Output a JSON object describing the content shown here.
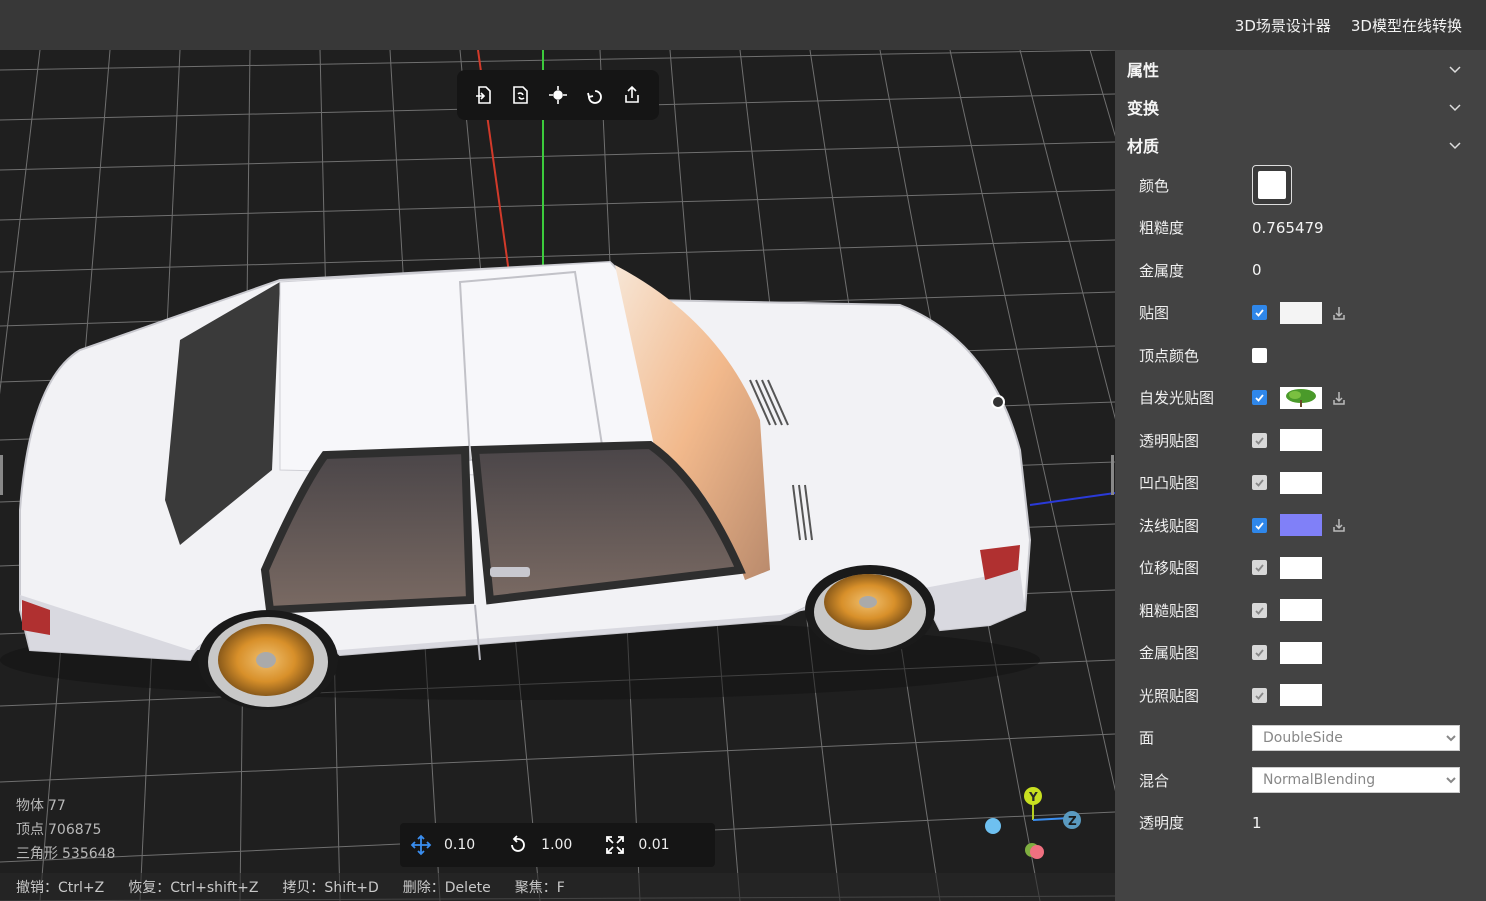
{
  "topbar": {
    "links": [
      "3D场景设计器",
      "3D模型在线转换"
    ]
  },
  "toolbar": {
    "icons": [
      "import-icon",
      "replace-icon",
      "focus-icon",
      "reset-icon",
      "export-icon"
    ]
  },
  "stats": {
    "objects_label": "物体",
    "objects": "77",
    "vertices_label": "顶点",
    "vertices": "706875",
    "triangles_label": "三角形",
    "triangles": "535648"
  },
  "hotkeys": [
    "撤销：Ctrl+Z",
    "恢复：Ctrl+shift+Z",
    "拷贝：Shift+D",
    "删除：Delete",
    "聚焦：F"
  ],
  "transform": {
    "translate": "0.10",
    "rotate": "1.00",
    "scale": "0.01"
  },
  "gizmo": {
    "y": "Y",
    "z": "Z"
  },
  "panel": {
    "sections": [
      "属性",
      "变换",
      "材质"
    ],
    "material": {
      "color_label": "颜色",
      "roughness_label": "粗糙度",
      "roughness": "0.765479",
      "metalness_label": "金属度",
      "metalness": "0",
      "map_label": "贴图",
      "vertex_colors_label": "顶点颜色",
      "emissive_map_label": "自发光贴图",
      "alpha_map_label": "透明贴图",
      "bump_map_label": "凹凸贴图",
      "normal_map_label": "法线贴图",
      "displacement_map_label": "位移贴图",
      "roughness_map_label": "粗糙贴图",
      "metalness_map_label": "金属贴图",
      "light_map_label": "光照贴图",
      "side_label": "面",
      "side": "DoubleSide",
      "blending_label": "混合",
      "blending": "NormalBlending",
      "opacity_label": "透明度",
      "opacity": "1"
    }
  },
  "colors": {
    "checkbox_on": "#2f87ea",
    "normal_map": "#8080f8",
    "panel_bg": "#434343",
    "topbar_bg": "#383838"
  }
}
